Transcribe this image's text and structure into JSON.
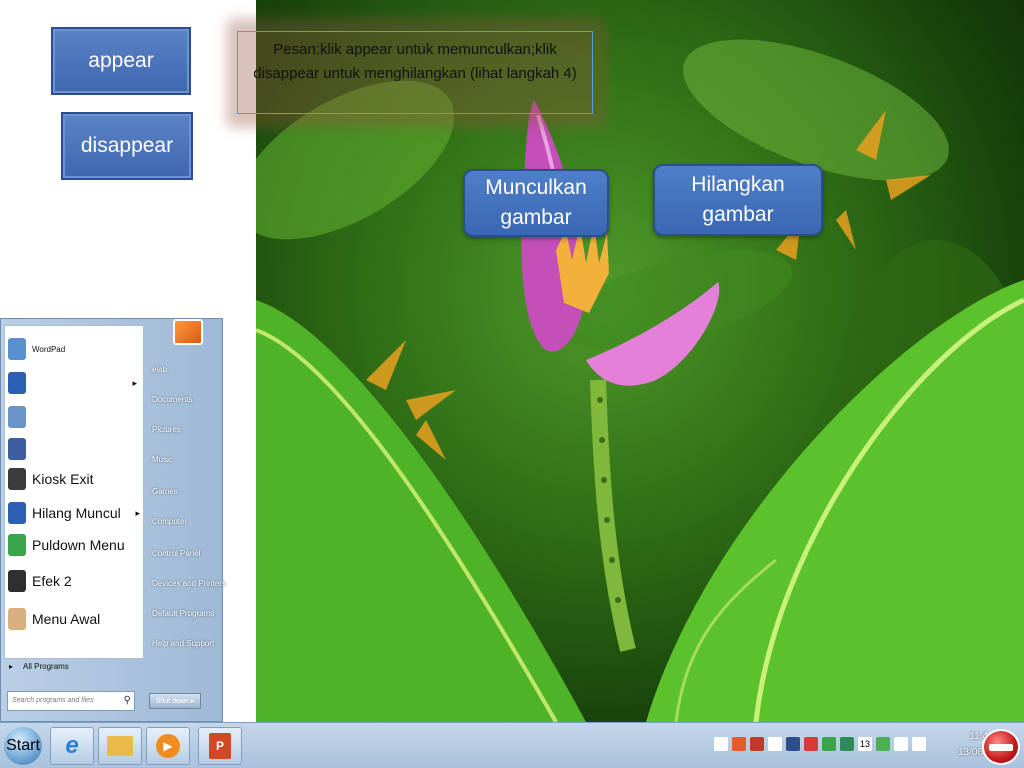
{
  "slide": {
    "appear_label": "appear",
    "disappear_label": "disappear",
    "message": "Pesan:klik appear untuk memunculkan;klik disappear untuk menghilangkan (lihat langkah 4)",
    "show_image_label": "Munculkan gambar",
    "hide_image_label": "Hilangkan gambar"
  },
  "start_menu": {
    "pinned": [
      {
        "label": "WordPad",
        "icon": "wordpad-icon",
        "color": "#5a8fd0"
      },
      {
        "label": "",
        "icon": "word-icon",
        "color": "#2b5fb4",
        "has_arrow": true
      },
      {
        "label": "",
        "icon": "document-icon",
        "color": "#6c93c7"
      },
      {
        "label": "",
        "icon": "media-icon",
        "color": "#3d5fa1"
      },
      {
        "label": "Kiosk Exit",
        "icon": "phone-icon",
        "color": "#3b3b3b"
      },
      {
        "label": "Hilang Muncul",
        "icon": "word-icon",
        "color": "#2b5fb4",
        "has_arrow": true
      },
      {
        "label": "Puldown Menu",
        "icon": "android-icon",
        "color": "#3aa44a"
      },
      {
        "label": "Efek 2",
        "icon": "phone-icon",
        "color": "#2f2f2f"
      },
      {
        "label": "Menu Awal",
        "icon": "user-icon",
        "color": "#d9b080"
      }
    ],
    "all_programs": "All Programs",
    "search_placeholder": "Search programs and files",
    "right_links": [
      "elab",
      "Documents",
      "Pictures",
      "Music",
      "Games",
      "Computer",
      "Control Panel",
      "Devices and Printers",
      "Default Programs",
      "Help and Support"
    ],
    "shutdown": "Shut down"
  },
  "taskbar": {
    "start_label": "Start",
    "apps": [
      {
        "name": "internet-explorer-icon",
        "color": "#2a7ed6"
      },
      {
        "name": "folder-icon",
        "color": "#e9b94a"
      },
      {
        "name": "media-player-icon",
        "color": "#f08c1e"
      },
      {
        "name": "powerpoint-icon",
        "color": "#d24726"
      }
    ],
    "tray_badge": "13",
    "clock_time": "11:4",
    "clock_date": "13/06/2"
  }
}
